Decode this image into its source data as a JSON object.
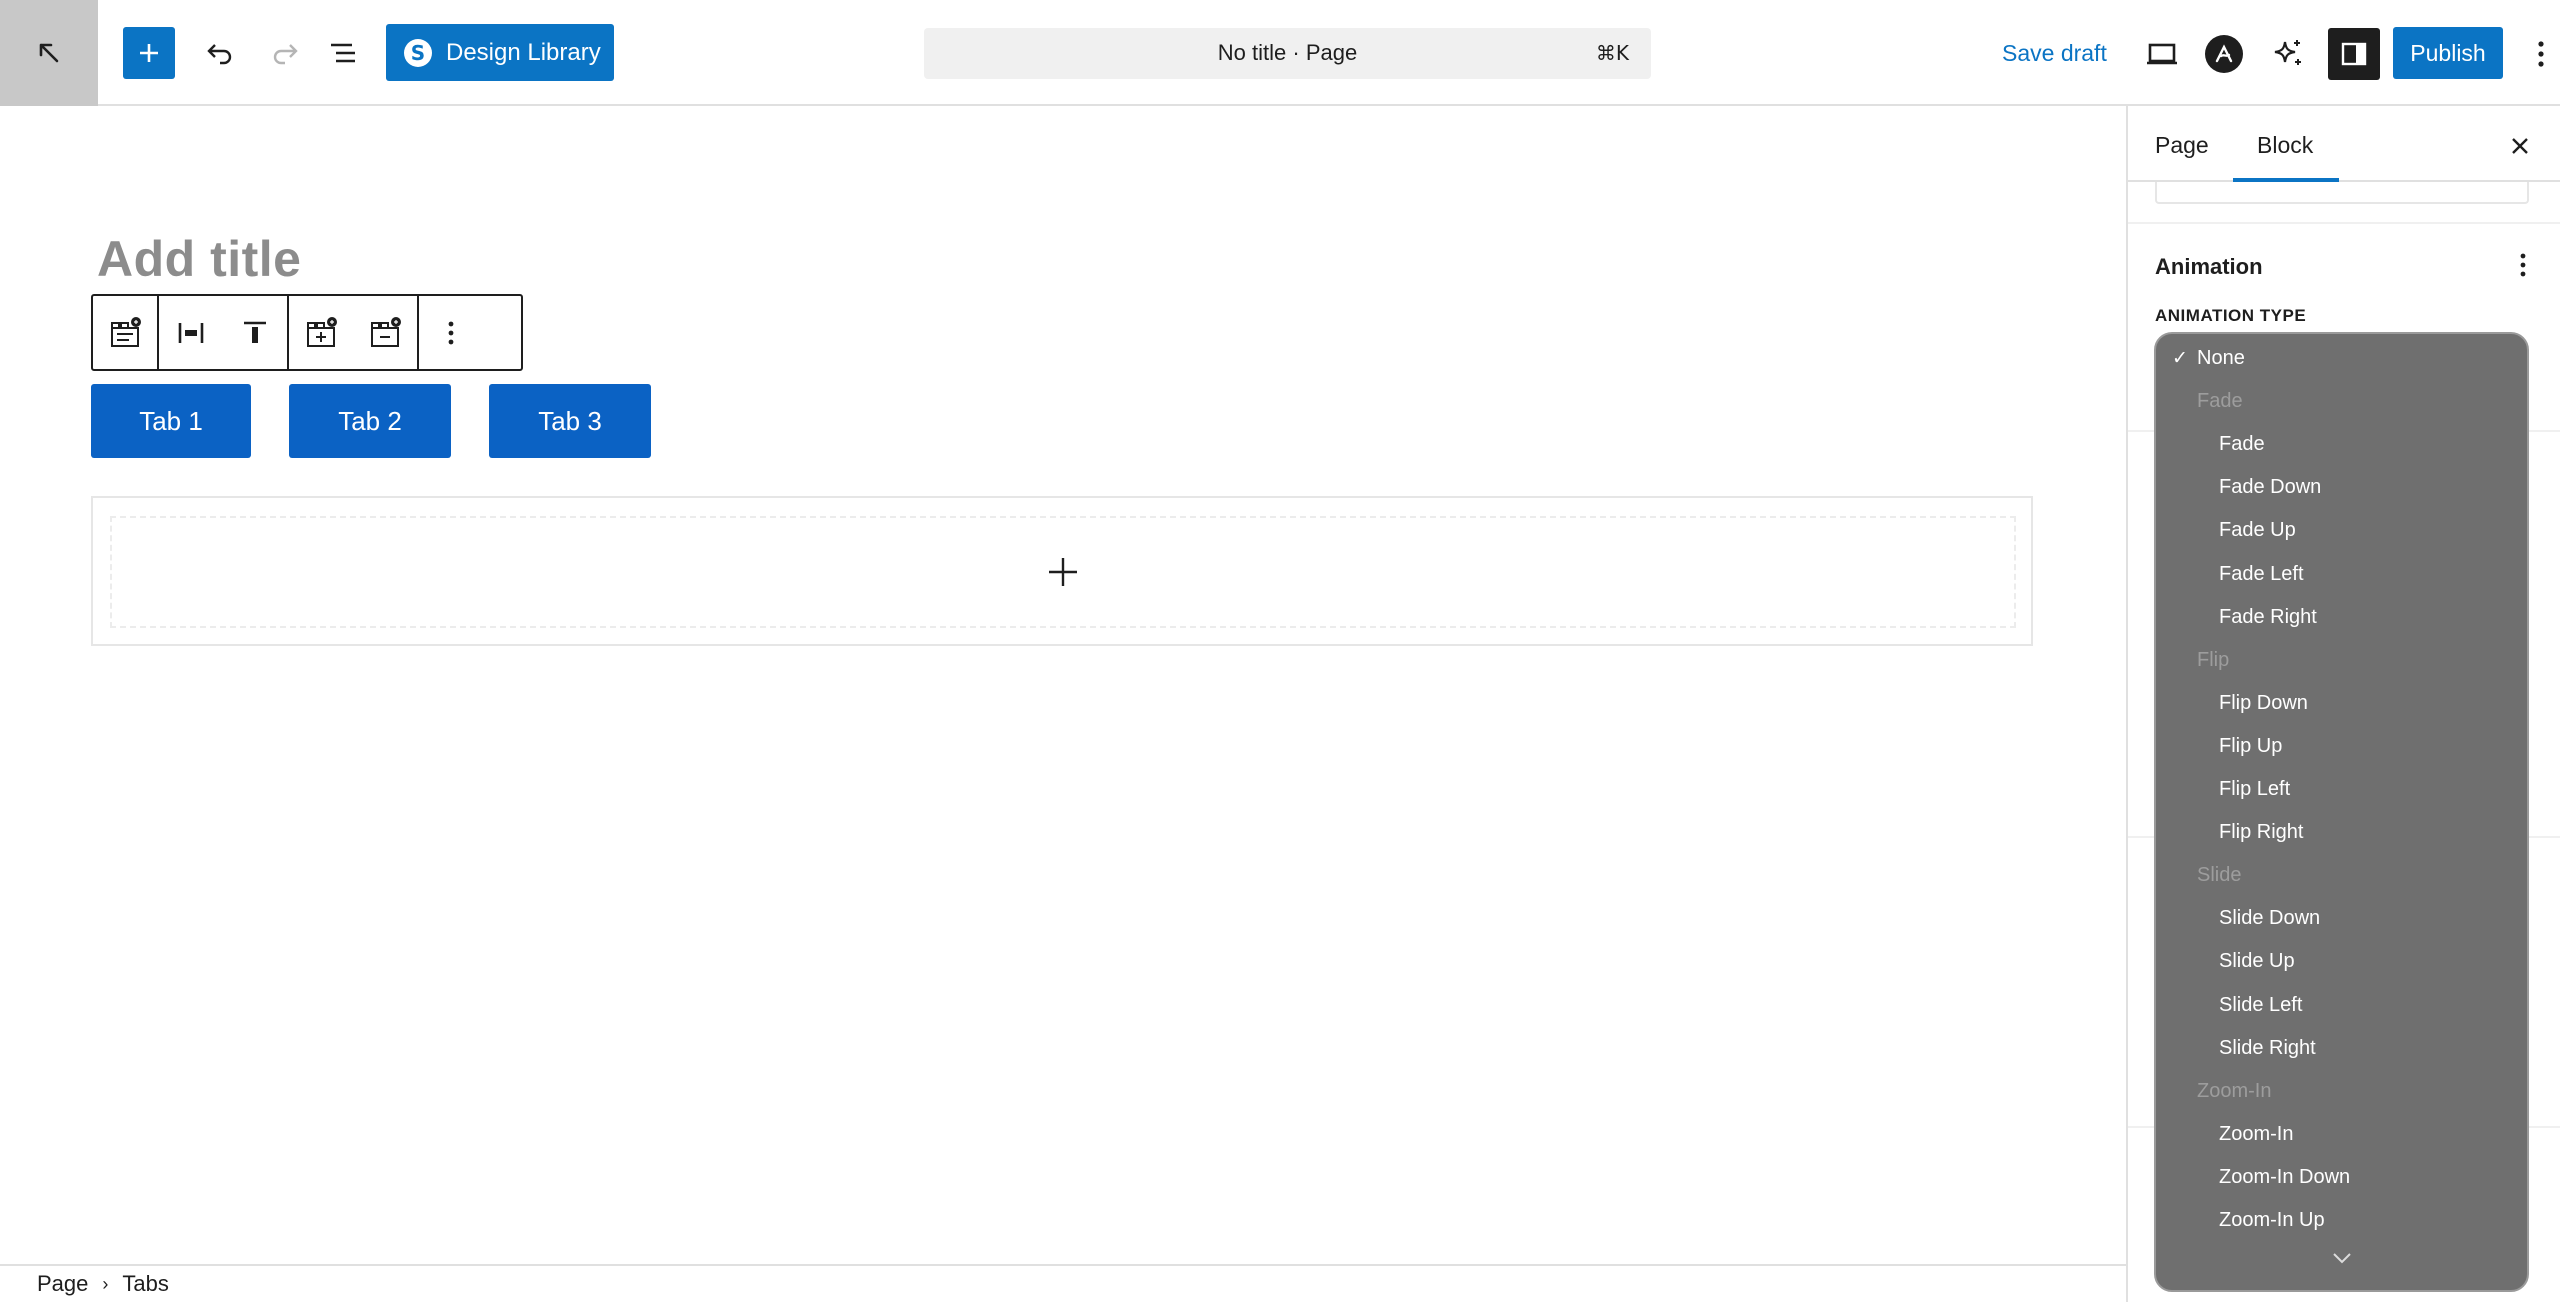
{
  "topbar": {
    "design_library_label": "Design Library",
    "document_title": "No title · Page",
    "shortcut": "⌘K",
    "save_draft_label": "Save draft",
    "publish_label": "Publish"
  },
  "editor": {
    "title_placeholder": "Add title",
    "tabs": [
      "Tab 1",
      "Tab 2",
      "Tab 3"
    ]
  },
  "statusbar": {
    "breadcrumbs": [
      "Page",
      "Tabs"
    ]
  },
  "sidebar": {
    "tabs": [
      "Page",
      "Block"
    ],
    "active_tab": "Block",
    "panel_title": "Animation",
    "field_label": "ANIMATION TYPE"
  },
  "dropdown": {
    "selected": "None",
    "items": [
      {
        "label": "None",
        "type": "option"
      },
      {
        "label": "Fade",
        "type": "group"
      },
      {
        "label": "Fade",
        "type": "option"
      },
      {
        "label": "Fade Down",
        "type": "option"
      },
      {
        "label": "Fade Up",
        "type": "option"
      },
      {
        "label": "Fade Left",
        "type": "option"
      },
      {
        "label": "Fade Right",
        "type": "option"
      },
      {
        "label": "Flip",
        "type": "group"
      },
      {
        "label": "Flip Down",
        "type": "option"
      },
      {
        "label": "Flip Up",
        "type": "option"
      },
      {
        "label": "Flip Left",
        "type": "option"
      },
      {
        "label": "Flip Right",
        "type": "option"
      },
      {
        "label": "Slide",
        "type": "group"
      },
      {
        "label": "Slide Down",
        "type": "option"
      },
      {
        "label": "Slide Up",
        "type": "option"
      },
      {
        "label": "Slide Left",
        "type": "option"
      },
      {
        "label": "Slide Right",
        "type": "option"
      },
      {
        "label": "Zoom-In",
        "type": "group"
      },
      {
        "label": "Zoom-In",
        "type": "option"
      },
      {
        "label": "Zoom-In Down",
        "type": "option"
      },
      {
        "label": "Zoom-In Up",
        "type": "option"
      }
    ]
  },
  "colors": {
    "accent": "#0b74c4",
    "tab_button": "#0b62c4",
    "dropdown_bg": "#6c6c6c"
  }
}
